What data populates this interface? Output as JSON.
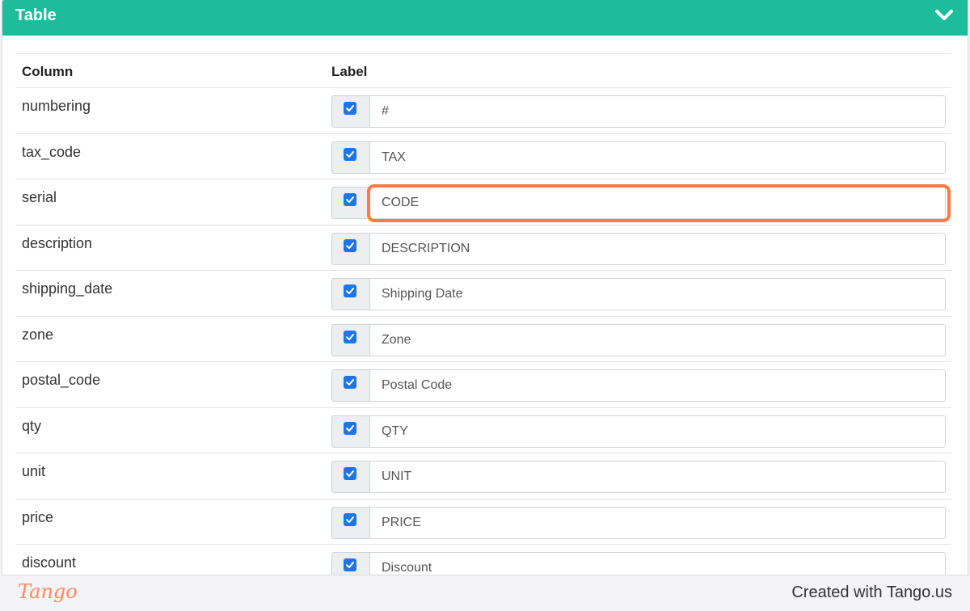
{
  "panel": {
    "title": "Table",
    "icon": "chevron-down-icon"
  },
  "table": {
    "headers": {
      "column": "Column",
      "label": "Label"
    },
    "rows": [
      {
        "column": "numbering",
        "checked": true,
        "label": "#"
      },
      {
        "column": "tax_code",
        "checked": true,
        "label": "TAX"
      },
      {
        "column": "serial",
        "checked": true,
        "label": "CODE"
      },
      {
        "column": "description",
        "checked": true,
        "label": "DESCRIPTION"
      },
      {
        "column": "shipping_date",
        "checked": true,
        "label": "Shipping Date"
      },
      {
        "column": "zone",
        "checked": true,
        "label": "Zone"
      },
      {
        "column": "postal_code",
        "checked": true,
        "label": "Postal Code"
      },
      {
        "column": "qty",
        "checked": true,
        "label": "QTY"
      },
      {
        "column": "unit",
        "checked": true,
        "label": "UNIT"
      },
      {
        "column": "price",
        "checked": true,
        "label": "PRICE"
      },
      {
        "column": "discount",
        "checked": true,
        "label": "Discount"
      }
    ]
  },
  "footer": {
    "logo": "Tango",
    "credit": "Created with Tango.us"
  },
  "colors": {
    "header": "#1dbc9c",
    "checkbox": "#1f74e8",
    "highlight": "#ff7a45"
  }
}
